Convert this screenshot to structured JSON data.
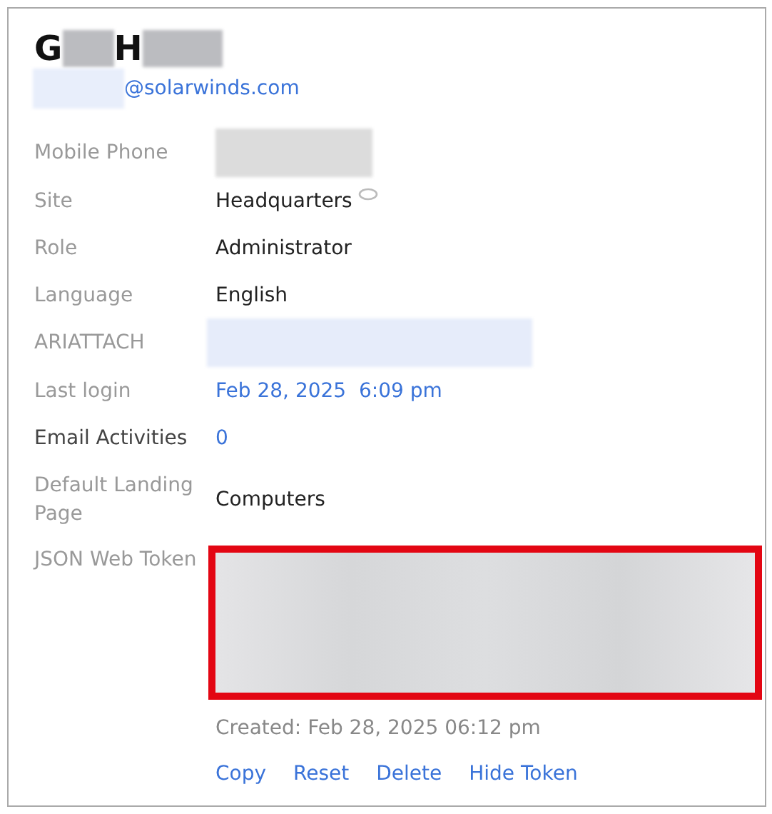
{
  "header": {
    "name_initials": [
      "G",
      "H"
    ],
    "email": "@solarwinds.com"
  },
  "fields": [
    {
      "label": "Mobile Phone",
      "emphasized": false,
      "kind": "blurred",
      "color": "#dcdcdc"
    },
    {
      "label": "Site",
      "emphasized": false,
      "kind": "text",
      "value": "Headquarters",
      "has_bubble": true
    },
    {
      "label": "Role",
      "emphasized": false,
      "kind": "text",
      "value": "Administrator"
    },
    {
      "label": "Language",
      "emphasized": false,
      "kind": "text",
      "value": "English"
    },
    {
      "label": "ARIATTACH",
      "emphasized": false,
      "kind": "blurred",
      "color": "#e6ecfa"
    },
    {
      "label": "Last login",
      "emphasized": false,
      "kind": "link",
      "value": "Feb 28, 2025  6:09 pm"
    },
    {
      "label": "Email Activities",
      "emphasized": true,
      "kind": "link",
      "value": "0"
    },
    {
      "label": "Default Landing Page",
      "emphasized": false,
      "kind": "text",
      "value": "Computers"
    }
  ],
  "token": {
    "label": "JSON Web Token",
    "highlighted": true,
    "created": "Created: Feb 28, 2025 06:12 pm",
    "actions": [
      "Copy",
      "Reset",
      "Delete",
      "Hide Token"
    ]
  }
}
